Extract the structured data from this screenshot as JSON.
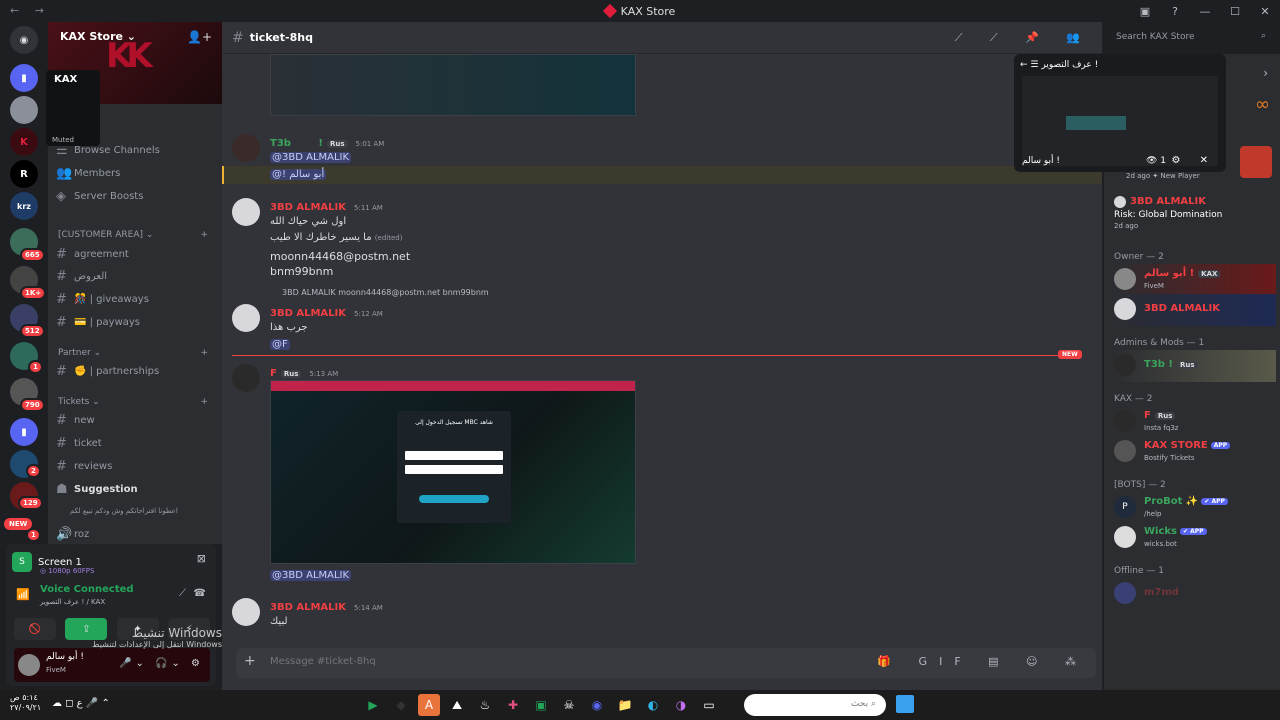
{
  "window": {
    "title": "KAX Store",
    "nav_arrows": "← →",
    "controls": [
      "▣",
      "?",
      "—",
      "☐",
      "✕"
    ]
  },
  "guilds": {
    "badges": [
      "665",
      "1K+",
      "512",
      "1",
      "790",
      "2",
      "129",
      "1"
    ],
    "new_label": "NEW",
    "icons": [
      "discord-icon",
      "folder-icon",
      "kax-icon",
      "r-icon",
      "krz-icon"
    ],
    "letters": {
      "r": "R",
      "krz": "krz"
    }
  },
  "popup": {
    "name": "KAX",
    "status": "Muted"
  },
  "server": {
    "name": "KAX Store ⌄",
    "partial_item": "ts",
    "items": [
      {
        "label": "Browse Channels",
        "icon": "☰"
      },
      {
        "label": "Members",
        "icon": "👥"
      },
      {
        "label": "Server Boosts",
        "icon": "◈"
      }
    ],
    "categories": [
      {
        "label": "[CUSTOMER AREA] ⌄",
        "add": "+"
      },
      {
        "label": "Partner ⌄",
        "add": "+"
      },
      {
        "label": "Tickets ⌄",
        "add": "+"
      }
    ],
    "channels_customer": [
      "agreement",
      "العروض",
      "🎊 | giveaways",
      "💳 | payways"
    ],
    "channels_partner": [
      "✊ | partnerships"
    ],
    "channels_tickets": [
      "new",
      "ticket",
      "reviews",
      "Suggestion",
      "اعطونا افتراحاتكم وش ودكم تبيع لكم",
      "roz"
    ]
  },
  "stream_panel": {
    "title": "Screen 1",
    "quality": "◎ 1080p 60FPS",
    "voice_status": "Voice Connected",
    "voice_channel": "عرف التصوير ! / KAX",
    "buttons": [
      "🚫",
      "⇪",
      "✦",
      "⚡"
    ]
  },
  "user": {
    "name": "أبو سالم !",
    "status": "FiveM",
    "controls": "🎤⌄ 🎧⌄ ⚙"
  },
  "watermark": {
    "line1": "تنشيط Windows",
    "line2": "انتقل إلى الإعدادات لتنشيط Windows"
  },
  "channel": {
    "name": "ticket-8hq",
    "header_icons": "⟋ ⟋ 📌 👥"
  },
  "search": {
    "placeholder": "Search KAX Store",
    "icon": "⌕"
  },
  "messages": [
    {
      "author": "T3b",
      "suffix": "!",
      "tag": "Rus",
      "time": "5:01 AM",
      "lines": [
        "@3BD ALMALIK",
        "@! أبو سالم"
      ]
    },
    {
      "author": "3BD ALMALIK",
      "time": "5:11 AM",
      "lines": [
        "اول شي حياك الله",
        "ما يسير خاطرك الا طيب",
        "(edited)",
        "moonn44468@postm.net",
        "bnm99bnm"
      ]
    },
    {
      "reply": "3BD ALMALIK moonn44468@postm.net bnm99bnm",
      "author": "3BD ALMALIK",
      "time": "5:12 AM",
      "lines": [
        "جرب هذا",
        "@F"
      ]
    },
    {
      "author": "F",
      "tag": "Rus",
      "time": "5:13 AM",
      "image_title": "تسجيل الدخول إلى MBC شاهد",
      "lines": [
        "@3BD ALMALIK"
      ]
    },
    {
      "author": "3BD ALMALIK",
      "time": "5:14 AM",
      "lines": [
        "لبيك"
      ]
    }
  ],
  "new_marker": "NEW",
  "composer": {
    "placeholder": "Message #ticket-8hq",
    "plus": "+",
    "tools": "🎁 GIF ▤ ☺ ⁂"
  },
  "stream_overlay": {
    "title": "← ☰ عرف التصوير !",
    "viewer": "أبو سالم !",
    "views": "👁 1",
    "icons": "⚙ ✕"
  },
  "members": {
    "arrow": "›",
    "activity_top": [
      {
        "name": "",
        "status": "2d ago  ✦ New Player"
      },
      {
        "name": "3BD ALMALIK",
        "activity": "Risk: Global Domination",
        "status": "2d ago"
      }
    ],
    "groups": [
      {
        "header": "Owner — 2",
        "items": [
          {
            "name": "أبو سالم !",
            "tag": "KAX",
            "status": "FiveM"
          },
          {
            "name": "3BD ALMALIK",
            "status": ""
          }
        ]
      },
      {
        "header": "Admins & Mods — 1",
        "items": [
          {
            "name": "T3b !",
            "tag": "Rus",
            "status": ""
          }
        ]
      },
      {
        "header": "KAX — 2",
        "items": [
          {
            "name": "F",
            "tag": "Rus",
            "status": "Insta fq3z"
          },
          {
            "name": "KAX STORE",
            "app": "APP",
            "status": "Bostify Tickets"
          }
        ]
      },
      {
        "header": "[BOTS] — 2",
        "items": [
          {
            "name": "ProBot ✨",
            "app": "✔ APP",
            "status": "/help"
          },
          {
            "name": "Wicks",
            "app": "✔ APP",
            "status": "wicks.bot"
          }
        ]
      },
      {
        "header": "Offline — 1",
        "items": [
          {
            "name": "m7md",
            "status": ""
          }
        ]
      }
    ]
  },
  "taskbar": {
    "time": "٥:١٤ ص",
    "date": "٢٧/٠٩/٢١",
    "sys_icons": "☁ ◻ ع 🎤 ⌃",
    "search_placeholder": "بحث",
    "search_icon": "⌕",
    "apps": [
      "▶",
      "◆",
      "A",
      "⛰",
      "♨",
      "✚",
      "▣",
      "☠",
      "◉",
      "📁",
      "◐",
      "◑",
      "▭"
    ]
  },
  "colors": {
    "accent": "#5865f2",
    "green": "#23a55a",
    "red": "#f23f43",
    "name_red": "#f23f43",
    "name_green": "#3ba55d"
  }
}
